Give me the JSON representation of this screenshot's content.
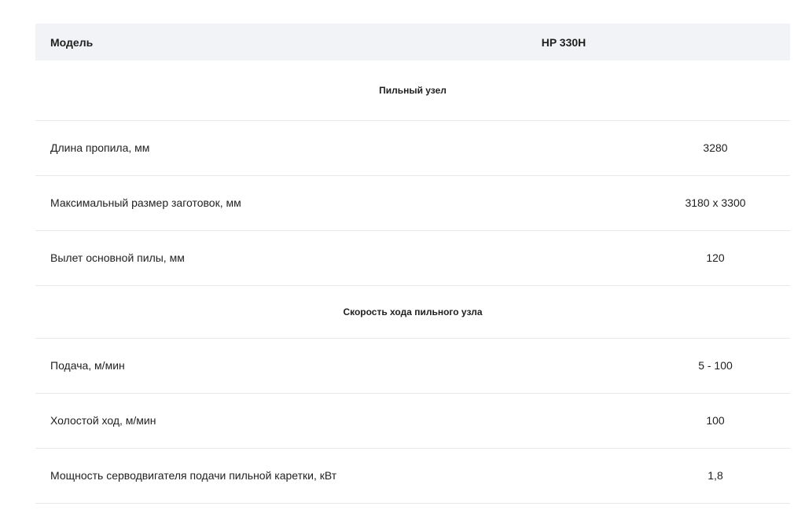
{
  "header": {
    "model_label": "Модель",
    "model_value": "HP 330H"
  },
  "sections": [
    {
      "title": "Пильный узел",
      "rows": [
        {
          "param": "Длина пропила, мм",
          "value": "3280"
        },
        {
          "param": "Максимальный размер заготовок, мм",
          "value": "3180 x 3300"
        },
        {
          "param": "Вылет основной пилы, мм",
          "value": "120"
        }
      ]
    },
    {
      "title": "Скорость хода пильного узла",
      "rows": [
        {
          "param": "Подача, м/мин",
          "value": "5 - 100"
        },
        {
          "param": "Холостой ход, м/мин",
          "value": "100"
        },
        {
          "param": "Мощность серводвигателя подачи пильной каретки, кВт",
          "value": "1,8"
        }
      ]
    }
  ]
}
